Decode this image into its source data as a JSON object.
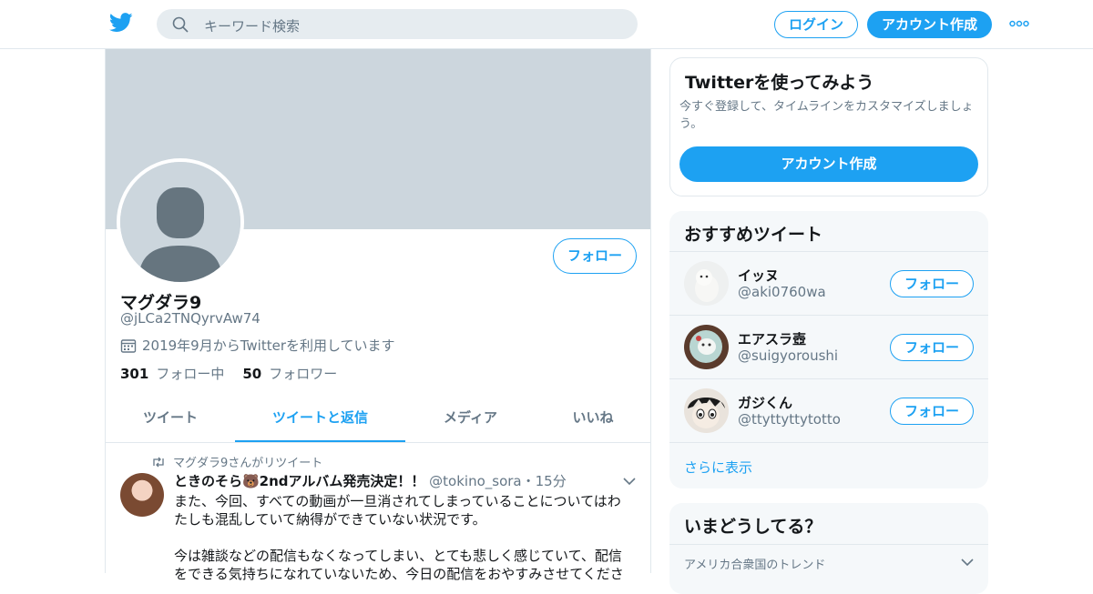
{
  "topbar": {
    "search_placeholder": "キーワード検索",
    "login_label": "ログイン",
    "signup_label": "アカウント作成"
  },
  "profile": {
    "follow_label": "フォロー",
    "name": "マグダラ9",
    "handle": "@jLCa2TNQyrvAw74",
    "joined": "2019年9月からTwitterを利用しています",
    "following_count": "301",
    "following_label": "フォロー中",
    "followers_count": "50",
    "followers_label": "フォロワー"
  },
  "tabs": [
    {
      "label": "ツイート"
    },
    {
      "label": "ツイートと返信"
    },
    {
      "label": "メディア"
    },
    {
      "label": "いいね"
    }
  ],
  "tweet": {
    "retweet_notice": "マグダラ9さんがリツイート",
    "author_name": "ときのそら🐻2ndアルバム発売決定！！",
    "author_handle": "@tokino_sora",
    "separator": "・",
    "time": "15分",
    "text_line1": "また、今回、すべての動画が一旦消されてしまっていることについてはわたしも混乱していて納得ができていない状況です。",
    "text_line2": "今は雑談などの配信もなくなってしまい、とても悲しく感じていて、配信をできる気持ちになれていないため、今日の配信をおやすみさせてくださ"
  },
  "signup_card": {
    "title": "Twitterを使ってみよう",
    "subtitle": "今すぐ登録して、タイムラインをカスタマイズしましょう。",
    "button_label": "アカウント作成"
  },
  "recommend_card": {
    "title": "おすすめツイート",
    "users": [
      {
        "name": "イッヌ",
        "handle": "@aki0760wa",
        "follow_label": "フォロー"
      },
      {
        "name": "エアスラ壺",
        "handle": "@suigyoroushi",
        "follow_label": "フォロー"
      },
      {
        "name": "ガジくん",
        "handle": "@ttyttyttytotto",
        "follow_label": "フォロー"
      }
    ],
    "show_more": "さらに表示"
  },
  "trends_card": {
    "title": "いまどうしてる？",
    "region": "アメリカ合衆国のトレンド"
  },
  "colors": {
    "accent": "#1da1f2",
    "banner": "#ccd6dd",
    "muted_text": "#657786",
    "border": "#e1e8ed"
  }
}
